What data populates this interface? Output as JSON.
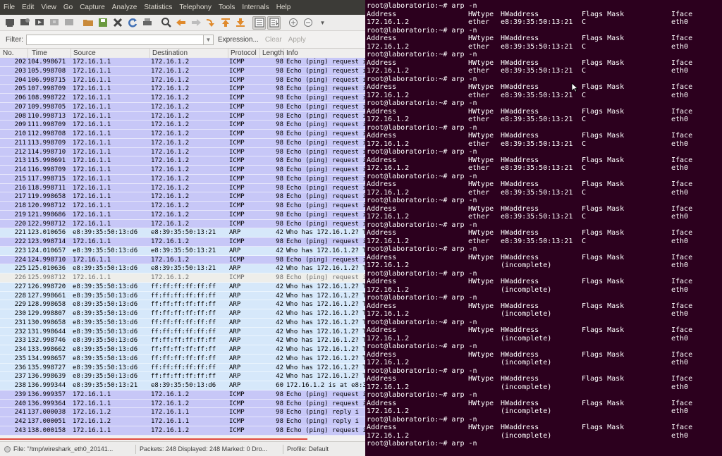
{
  "wireshark": {
    "menu": [
      "File",
      "Edit",
      "View",
      "Go",
      "Capture",
      "Analyze",
      "Statistics",
      "Telephony",
      "Tools",
      "Internals",
      "Help"
    ],
    "filter": {
      "label": "Filter:",
      "value": "",
      "expression": "Expression...",
      "clear": "Clear",
      "apply": "Apply"
    },
    "columns": [
      "No.",
      "Time",
      "Source",
      "Destination",
      "Protocol",
      "Length",
      "Info"
    ],
    "packets": [
      {
        "no": "202",
        "time": "104.998671",
        "src": "172.16.1.1",
        "dst": "172.16.1.2",
        "proto": "ICMP",
        "len": "98",
        "info": "Echo (ping) request  i",
        "kind": "icmp"
      },
      {
        "no": "203",
        "time": "105.998708",
        "src": "172.16.1.1",
        "dst": "172.16.1.2",
        "proto": "ICMP",
        "len": "98",
        "info": "Echo (ping) request  i",
        "kind": "icmp"
      },
      {
        "no": "204",
        "time": "106.998715",
        "src": "172.16.1.1",
        "dst": "172.16.1.2",
        "proto": "ICMP",
        "len": "98",
        "info": "Echo (ping) request  i",
        "kind": "icmp"
      },
      {
        "no": "205",
        "time": "107.998709",
        "src": "172.16.1.1",
        "dst": "172.16.1.2",
        "proto": "ICMP",
        "len": "98",
        "info": "Echo (ping) request  i",
        "kind": "icmp"
      },
      {
        "no": "206",
        "time": "108.998722",
        "src": "172.16.1.1",
        "dst": "172.16.1.2",
        "proto": "ICMP",
        "len": "98",
        "info": "Echo (ping) request  i",
        "kind": "icmp"
      },
      {
        "no": "207",
        "time": "109.998705",
        "src": "172.16.1.1",
        "dst": "172.16.1.2",
        "proto": "ICMP",
        "len": "98",
        "info": "Echo (ping) request  i",
        "kind": "icmp"
      },
      {
        "no": "208",
        "time": "110.998713",
        "src": "172.16.1.1",
        "dst": "172.16.1.2",
        "proto": "ICMP",
        "len": "98",
        "info": "Echo (ping) request  i",
        "kind": "icmp"
      },
      {
        "no": "209",
        "time": "111.998709",
        "src": "172.16.1.1",
        "dst": "172.16.1.2",
        "proto": "ICMP",
        "len": "98",
        "info": "Echo (ping) request  i",
        "kind": "icmp"
      },
      {
        "no": "210",
        "time": "112.998708",
        "src": "172.16.1.1",
        "dst": "172.16.1.2",
        "proto": "ICMP",
        "len": "98",
        "info": "Echo (ping) request  i",
        "kind": "icmp"
      },
      {
        "no": "211",
        "time": "113.998709",
        "src": "172.16.1.1",
        "dst": "172.16.1.2",
        "proto": "ICMP",
        "len": "98",
        "info": "Echo (ping) request  i",
        "kind": "icmp"
      },
      {
        "no": "212",
        "time": "114.998710",
        "src": "172.16.1.1",
        "dst": "172.16.1.2",
        "proto": "ICMP",
        "len": "98",
        "info": "Echo (ping) request  i",
        "kind": "icmp"
      },
      {
        "no": "213",
        "time": "115.998691",
        "src": "172.16.1.1",
        "dst": "172.16.1.2",
        "proto": "ICMP",
        "len": "98",
        "info": "Echo (ping) request  i",
        "kind": "icmp"
      },
      {
        "no": "214",
        "time": "116.998709",
        "src": "172.16.1.1",
        "dst": "172.16.1.2",
        "proto": "ICMP",
        "len": "98",
        "info": "Echo (ping) request  i",
        "kind": "icmp"
      },
      {
        "no": "215",
        "time": "117.998715",
        "src": "172.16.1.1",
        "dst": "172.16.1.2",
        "proto": "ICMP",
        "len": "98",
        "info": "Echo (ping) request  i",
        "kind": "icmp"
      },
      {
        "no": "216",
        "time": "118.998711",
        "src": "172.16.1.1",
        "dst": "172.16.1.2",
        "proto": "ICMP",
        "len": "98",
        "info": "Echo (ping) request  i",
        "kind": "icmp"
      },
      {
        "no": "217",
        "time": "119.998658",
        "src": "172.16.1.1",
        "dst": "172.16.1.2",
        "proto": "ICMP",
        "len": "98",
        "info": "Echo (ping) request  i",
        "kind": "icmp"
      },
      {
        "no": "218",
        "time": "120.998712",
        "src": "172.16.1.1",
        "dst": "172.16.1.2",
        "proto": "ICMP",
        "len": "98",
        "info": "Echo (ping) request  i",
        "kind": "icmp"
      },
      {
        "no": "219",
        "time": "121.998686",
        "src": "172.16.1.1",
        "dst": "172.16.1.2",
        "proto": "ICMP",
        "len": "98",
        "info": "Echo (ping) request  i",
        "kind": "icmp"
      },
      {
        "no": "220",
        "time": "122.998712",
        "src": "172.16.1.1",
        "dst": "172.16.1.2",
        "proto": "ICMP",
        "len": "98",
        "info": "Echo (ping) request  i",
        "kind": "icmp"
      },
      {
        "no": "221",
        "time": "123.010656",
        "src": "e8:39:35:50:13:d6",
        "dst": "e8:39:35:50:13:21",
        "proto": "ARP",
        "len": "42",
        "info": "Who has 172.16.1.2?  T",
        "kind": "arp"
      },
      {
        "no": "222",
        "time": "123.998714",
        "src": "172.16.1.1",
        "dst": "172.16.1.2",
        "proto": "ICMP",
        "len": "98",
        "info": "Echo (ping) request  i",
        "kind": "icmp"
      },
      {
        "no": "223",
        "time": "124.010657",
        "src": "e8:39:35:50:13:d6",
        "dst": "e8:39:35:50:13:21",
        "proto": "ARP",
        "len": "42",
        "info": "Who has 172.16.1.2?  T",
        "kind": "arp"
      },
      {
        "no": "224",
        "time": "124.998710",
        "src": "172.16.1.1",
        "dst": "172.16.1.2",
        "proto": "ICMP",
        "len": "98",
        "info": "Echo (ping) request  i",
        "kind": "icmp"
      },
      {
        "no": "225",
        "time": "125.010636",
        "src": "e8:39:35:50:13:d6",
        "dst": "e8:39:35:50:13:21",
        "proto": "ARP",
        "len": "42",
        "info": "Who has 172.16.1.2?  T",
        "kind": "arp"
      },
      {
        "no": "226",
        "time": "125.998712",
        "src": "172.16.1.1",
        "dst": "172.16.1.2",
        "proto": "ICMP",
        "len": "98",
        "info": "Echo (ping) request  i",
        "kind": "sel"
      },
      {
        "no": "227",
        "time": "126.998720",
        "src": "e8:39:35:50:13:d6",
        "dst": "ff:ff:ff:ff:ff:ff",
        "proto": "ARP",
        "len": "42",
        "info": "Who has 172.16.1.2?  T",
        "kind": "arp"
      },
      {
        "no": "228",
        "time": "127.998661",
        "src": "e8:39:35:50:13:d6",
        "dst": "ff:ff:ff:ff:ff:ff",
        "proto": "ARP",
        "len": "42",
        "info": "Who has 172.16.1.2?  T",
        "kind": "arp"
      },
      {
        "no": "229",
        "time": "128.998658",
        "src": "e8:39:35:50:13:d6",
        "dst": "ff:ff:ff:ff:ff:ff",
        "proto": "ARP",
        "len": "42",
        "info": "Who has 172.16.1.2?  T",
        "kind": "arp"
      },
      {
        "no": "230",
        "time": "129.998807",
        "src": "e8:39:35:50:13:d6",
        "dst": "ff:ff:ff:ff:ff:ff",
        "proto": "ARP",
        "len": "42",
        "info": "Who has 172.16.1.2?  T",
        "kind": "arp"
      },
      {
        "no": "231",
        "time": "130.998658",
        "src": "e8:39:35:50:13:d6",
        "dst": "ff:ff:ff:ff:ff:ff",
        "proto": "ARP",
        "len": "42",
        "info": "Who has 172.16.1.2?  T",
        "kind": "arp"
      },
      {
        "no": "232",
        "time": "131.998644",
        "src": "e8:39:35:50:13:d6",
        "dst": "ff:ff:ff:ff:ff:ff",
        "proto": "ARP",
        "len": "42",
        "info": "Who has 172.16.1.2?  T",
        "kind": "arp"
      },
      {
        "no": "233",
        "time": "132.998746",
        "src": "e8:39:35:50:13:d6",
        "dst": "ff:ff:ff:ff:ff:ff",
        "proto": "ARP",
        "len": "42",
        "info": "Who has 172.16.1.2?  T",
        "kind": "arp"
      },
      {
        "no": "234",
        "time": "133.998662",
        "src": "e8:39:35:50:13:d6",
        "dst": "ff:ff:ff:ff:ff:ff",
        "proto": "ARP",
        "len": "42",
        "info": "Who has 172.16.1.2?  T",
        "kind": "arp"
      },
      {
        "no": "235",
        "time": "134.998657",
        "src": "e8:39:35:50:13:d6",
        "dst": "ff:ff:ff:ff:ff:ff",
        "proto": "ARP",
        "len": "42",
        "info": "Who has 172.16.1.2?  T",
        "kind": "arp"
      },
      {
        "no": "236",
        "time": "135.998727",
        "src": "e8:39:35:50:13:d6",
        "dst": "ff:ff:ff:ff:ff:ff",
        "proto": "ARP",
        "len": "42",
        "info": "Who has 172.16.1.2?  T",
        "kind": "arp"
      },
      {
        "no": "237",
        "time": "136.998639",
        "src": "e8:39:35:50:13:d6",
        "dst": "ff:ff:ff:ff:ff:ff",
        "proto": "ARP",
        "len": "42",
        "info": "Who has 172.16.1.2?  T",
        "kind": "arp"
      },
      {
        "no": "238",
        "time": "136.999344",
        "src": "e8:39:35:50:13:21",
        "dst": "e8:39:35:50:13:d6",
        "proto": "ARP",
        "len": "60",
        "info": "172.16.1.2 is at e8:39",
        "kind": "arp"
      },
      {
        "no": "239",
        "time": "136.999357",
        "src": "172.16.1.1",
        "dst": "172.16.1.2",
        "proto": "ICMP",
        "len": "98",
        "info": "Echo (ping) request  i",
        "kind": "icmp"
      },
      {
        "no": "240",
        "time": "136.999364",
        "src": "172.16.1.1",
        "dst": "172.16.1.2",
        "proto": "ICMP",
        "len": "98",
        "info": "Echo (ping) request  i",
        "kind": "icmp"
      },
      {
        "no": "241",
        "time": "137.000038",
        "src": "172.16.1.2",
        "dst": "172.16.1.1",
        "proto": "ICMP",
        "len": "98",
        "info": "Echo (ping) reply    i",
        "kind": "icmp"
      },
      {
        "no": "242",
        "time": "137.000051",
        "src": "172.16.1.2",
        "dst": "172.16.1.1",
        "proto": "ICMP",
        "len": "98",
        "info": "Echo (ping) reply    i",
        "kind": "icmp"
      },
      {
        "no": "243",
        "time": "138.000158",
        "src": "172.16.1.1",
        "dst": "172.16.1.2",
        "proto": "ICMP",
        "len": "98",
        "info": "Echo (ping) request  i",
        "kind": "icmp"
      }
    ],
    "status": {
      "file": "File: \"/tmp/wireshark_eth0_20141...",
      "packets": "Packets: 248 Displayed: 248 Marked: 0 Dro...",
      "profile": "Profile: Default"
    }
  },
  "terminal": {
    "prompt": "root@laboratorio:~# arp -n",
    "header": {
      "address": "Address",
      "hwtype": "HWtype",
      "hwaddress": "HWaddress",
      "flags": "Flags Mask",
      "iface": "Iface"
    },
    "entries": [
      {
        "address": "172.16.1.2",
        "hwtype": "ether",
        "hwaddress": "e8:39:35:50:13:21",
        "flags": "C",
        "iface": "eth0"
      },
      {
        "address": "172.16.1.2",
        "hwtype": "ether",
        "hwaddress": "e8:39:35:50:13:21",
        "flags": "C",
        "iface": "eth0"
      },
      {
        "address": "172.16.1.2",
        "hwtype": "ether",
        "hwaddress": "e8:39:35:50:13:21",
        "flags": "C",
        "iface": "eth0"
      },
      {
        "address": "172.16.1.2",
        "hwtype": "ether",
        "hwaddress": "e8:39:35:50:13:21",
        "flags": "C",
        "iface": "eth0"
      },
      {
        "address": "172.16.1.2",
        "hwtype": "ether",
        "hwaddress": "e8:39:35:50:13:21",
        "flags": "C",
        "iface": "eth0"
      },
      {
        "address": "172.16.1.2",
        "hwtype": "ether",
        "hwaddress": "e8:39:35:50:13:21",
        "flags": "C",
        "iface": "eth0"
      },
      {
        "address": "172.16.1.2",
        "hwtype": "ether",
        "hwaddress": "e8:39:35:50:13:21",
        "flags": "C",
        "iface": "eth0"
      },
      {
        "address": "172.16.1.2",
        "hwtype": "ether",
        "hwaddress": "e8:39:35:50:13:21",
        "flags": "C",
        "iface": "eth0"
      },
      {
        "address": "172.16.1.2",
        "hwtype": "ether",
        "hwaddress": "e8:39:35:50:13:21",
        "flags": "C",
        "iface": "eth0"
      },
      {
        "address": "172.16.1.2",
        "hwtype": "ether",
        "hwaddress": "e8:39:35:50:13:21",
        "flags": "C",
        "iface": "eth0"
      },
      {
        "address": "172.16.1.2",
        "hwtype": "",
        "hwaddress": "(incomplete)",
        "flags": "",
        "iface": "eth0"
      },
      {
        "address": "172.16.1.2",
        "hwtype": "",
        "hwaddress": "(incomplete)",
        "flags": "",
        "iface": "eth0"
      },
      {
        "address": "172.16.1.2",
        "hwtype": "",
        "hwaddress": "(incomplete)",
        "flags": "",
        "iface": "eth0"
      },
      {
        "address": "172.16.1.2",
        "hwtype": "",
        "hwaddress": "(incomplete)",
        "flags": "",
        "iface": "eth0"
      },
      {
        "address": "172.16.1.2",
        "hwtype": "",
        "hwaddress": "(incomplete)",
        "flags": "",
        "iface": "eth0"
      },
      {
        "address": "172.16.1.2",
        "hwtype": "",
        "hwaddress": "(incomplete)",
        "flags": "",
        "iface": "eth0"
      },
      {
        "address": "172.16.1.2",
        "hwtype": "",
        "hwaddress": "(incomplete)",
        "flags": "",
        "iface": "eth0"
      },
      {
        "address": "172.16.1.2",
        "hwtype": "",
        "hwaddress": "(incomplete)",
        "flags": "",
        "iface": "eth0"
      }
    ]
  }
}
